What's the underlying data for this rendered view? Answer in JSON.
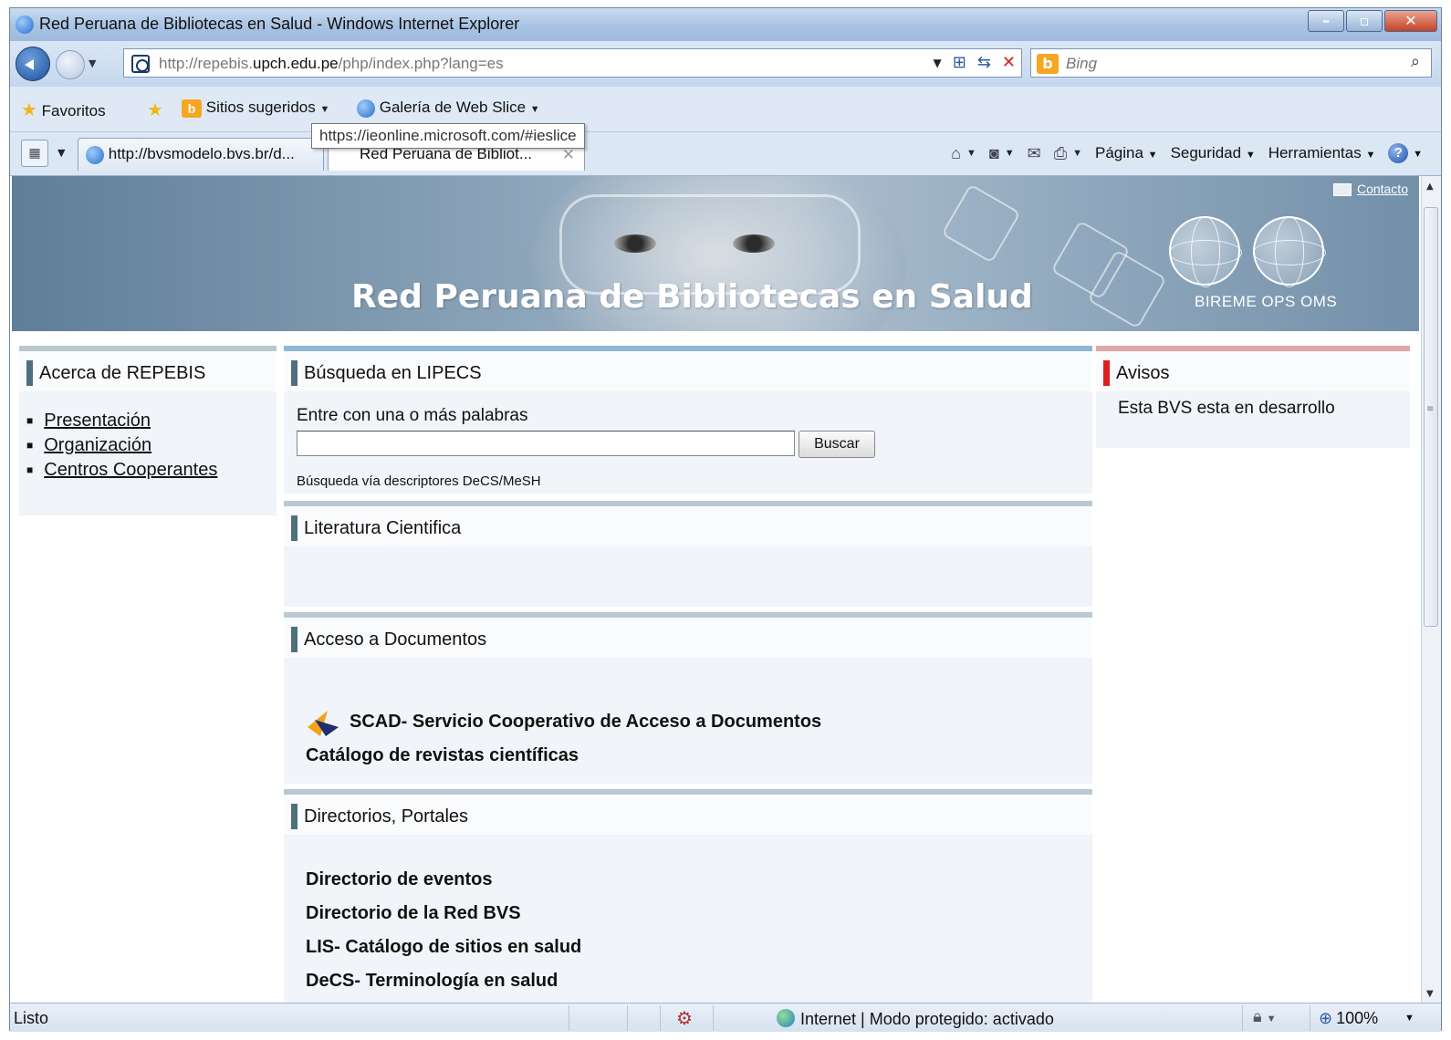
{
  "window": {
    "title": "Red Peruana de Bibliotecas en Salud - Windows Internet Explorer",
    "controls": [
      "minimize",
      "maximize",
      "close"
    ]
  },
  "navbar": {
    "url_host_prefix": "http://repebis.",
    "url_host_bold": "upch.edu.pe",
    "url_path": "/php/index.php?lang=es",
    "search_placeholder": "Bing"
  },
  "favorites_bar": {
    "favorites_label": "Favoritos",
    "suggested_sites_label": "Sitios sugeridos",
    "web_slice_label": "Galería de Web Slice",
    "tooltip": "https://ieonline.microsoft.com/#ieslice"
  },
  "tabs": [
    {
      "label": "http://bvsmodelo.bvs.br/d...",
      "active": false
    },
    {
      "label": "Red Peruana de Bibliot...",
      "active": true
    }
  ],
  "command_bar": {
    "page_label": "Página",
    "safety_label": "Seguridad",
    "tools_label": "Herramientas"
  },
  "banner": {
    "title": "Red Peruana de Bibliotecas en Salud",
    "contact_label": "Contacto",
    "orgs": "BIREME  OPS  OMS"
  },
  "left": {
    "heading": "Acerca de REPEBIS",
    "links": [
      "Presentación",
      "Organización",
      "Centros Cooperantes"
    ]
  },
  "search_section": {
    "heading": "Búsqueda en LIPECS",
    "hint": "Entre con una o más palabras",
    "input_value": "",
    "button_label": "Buscar",
    "decs_link": "Búsqueda vía descriptores DeCS/MeSH"
  },
  "literature_section": {
    "heading": "Literatura Cientifica"
  },
  "documents_section": {
    "heading": "Acceso a Documentos",
    "links": [
      "SCAD- Servicio Cooperativo de Acceso a Documentos",
      "Catálogo de revistas científicas"
    ]
  },
  "directories_section": {
    "heading": "Directorios, Portales",
    "links": [
      "Directorio de eventos",
      "Directorio de la Red BVS",
      "LIS- Catálogo de sitios en salud",
      "DeCS- Terminología en salud"
    ]
  },
  "notices": {
    "heading": "Avisos",
    "message": "Esta BVS esta en desarrollo"
  },
  "statusbar": {
    "status": "Listo",
    "zone": "Internet | Modo protegido: activado",
    "zoom": "100%"
  },
  "colors": {
    "banner": "#7f99b0",
    "left_strip": "#b9c7cf",
    "search_strip": "#8fb6d4",
    "notices_strip": "#e0a6a6",
    "notices_bar": "#e01d1d",
    "heading_bar": "#4f6f7e"
  }
}
